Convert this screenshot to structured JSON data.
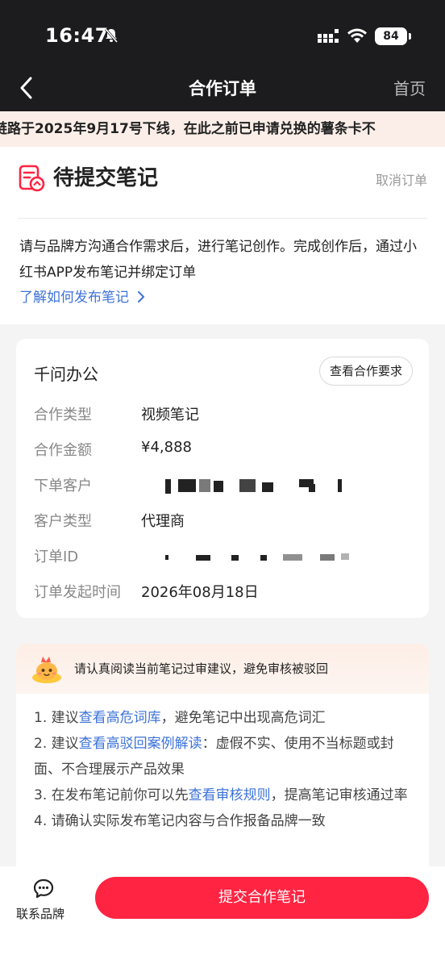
{
  "status_bar": {
    "time": "16:47",
    "battery": "84"
  },
  "nav": {
    "title": "合作订单",
    "home": "首页"
  },
  "notice": {
    "text": "链路于2025年9月17号下线，在此之前已申请兑换的薯条卡不"
  },
  "order_status": {
    "title": "待提交笔记",
    "cancel": "取消订单",
    "description": "请与品牌方沟通合作需求后，进行笔记创作。完成创作后，通过小红书APP发布笔记并绑定订单",
    "learn_link": "了解如何发布笔记"
  },
  "order_card": {
    "brand": "千问办公",
    "requirements_button": "查看合作要求",
    "rows": [
      {
        "label": "合作类型",
        "value": "视频笔记"
      },
      {
        "label": "合作金额",
        "value": "¥4,888"
      },
      {
        "label": "下单客户",
        "value": ""
      },
      {
        "label": "客户类型",
        "value": "代理商"
      },
      {
        "label": "订单ID",
        "value": ""
      },
      {
        "label": "订单发起时间",
        "value": "2026年08月18日"
      }
    ]
  },
  "advice": {
    "title": "请认真阅读当前笔记过审建议，避免审核被驳回",
    "items": [
      {
        "prefix": "1. 建议",
        "link": "查看高危词库",
        "suffix": "，避免笔记中出现高危词汇"
      },
      {
        "prefix": "2. 建议",
        "link": "查看高驳回案例解读",
        "suffix": "：虚假不实、使用不当标题或封面、不合理展示产品效果"
      },
      {
        "prefix": "3. 在发布笔记前你可以先",
        "link": "查看审核规则",
        "suffix": "，提高笔记审核通过率"
      },
      {
        "prefix": "4. 请确认实际发布笔记内容与合作报备品牌一致",
        "link": "",
        "suffix": ""
      }
    ]
  },
  "bottom_bar": {
    "contact": "联系品牌",
    "submit": "提交合作笔记"
  },
  "colors": {
    "accent": "#ff2442",
    "link": "#3d73d8"
  }
}
